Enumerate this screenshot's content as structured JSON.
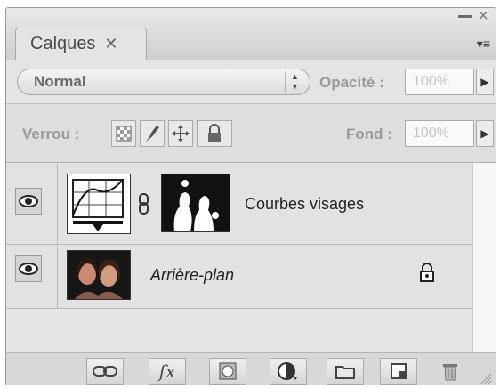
{
  "tab": {
    "label": "Calques",
    "close": "✕"
  },
  "window": {
    "minimize": "–",
    "close": "×",
    "panel_menu": "▾≡"
  },
  "blend": {
    "mode": "Normal",
    "arrows": "▲\n▼"
  },
  "opacity": {
    "label": "Opacité :",
    "value": "100%"
  },
  "lock": {
    "label": "Verrou :"
  },
  "fill": {
    "label": "Fond :",
    "value": "100%"
  },
  "layers": [
    {
      "name": "Courbes visages",
      "italic": false
    },
    {
      "name": "Arrière-plan",
      "italic": true,
      "locked": true
    }
  ],
  "bottom_icons": [
    "link-icon",
    "fx-icon",
    "mask-icon",
    "adjustment-icon",
    "folder-icon",
    "new-layer-icon",
    "trash-icon"
  ],
  "fx_label": "fx",
  "colors": {
    "panel": "#d6d6d6",
    "text": "#3a3a3a",
    "thumb_dark": "#1a1a1a"
  }
}
